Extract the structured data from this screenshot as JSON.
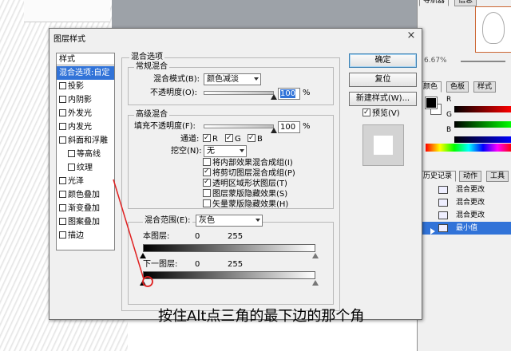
{
  "panels": {
    "navigator_tabs": [
      "导航器",
      "信息"
    ],
    "zoom": "6.67%",
    "color_tabs": [
      "颜色",
      "色板",
      "样式"
    ],
    "channels": [
      "R",
      "G",
      "B"
    ],
    "history_tabs": [
      "历史记录",
      "动作",
      "工具"
    ],
    "history_items": [
      "混合更改",
      "混合更改",
      "混合更改",
      "最小值"
    ],
    "accent": "#3173d8"
  },
  "dialog": {
    "title": "图层样式",
    "close_glyph": "×",
    "styles_header": "样式",
    "style_items": [
      {
        "label": "混合选项:自定",
        "checkbox": false,
        "selected": true,
        "indent": false
      },
      {
        "label": "投影",
        "checkbox": true,
        "selected": false,
        "indent": false
      },
      {
        "label": "内阴影",
        "checkbox": true,
        "selected": false,
        "indent": false
      },
      {
        "label": "外发光",
        "checkbox": true,
        "selected": false,
        "indent": false
      },
      {
        "label": "内发光",
        "checkbox": true,
        "selected": false,
        "indent": false
      },
      {
        "label": "斜面和浮雕",
        "checkbox": true,
        "selected": false,
        "indent": false
      },
      {
        "label": "等高线",
        "checkbox": true,
        "selected": false,
        "indent": true
      },
      {
        "label": "纹理",
        "checkbox": true,
        "selected": false,
        "indent": true
      },
      {
        "label": "光泽",
        "checkbox": true,
        "selected": false,
        "indent": false
      },
      {
        "label": "颜色叠加",
        "checkbox": true,
        "selected": false,
        "indent": false
      },
      {
        "label": "渐变叠加",
        "checkbox": true,
        "selected": false,
        "indent": false
      },
      {
        "label": "图案叠加",
        "checkbox": true,
        "selected": false,
        "indent": false
      },
      {
        "label": "描边",
        "checkbox": true,
        "selected": false,
        "indent": false
      }
    ],
    "blending_options_title": "混合选项",
    "general": {
      "title": "常规混合",
      "mode_label": "混合模式(B):",
      "mode_value": "颜色减淡",
      "opacity_label": "不透明度(O):",
      "opacity_value": "100",
      "opacity_unit": "%"
    },
    "advanced": {
      "title": "高级混合",
      "fill_label": "填充不透明度(F):",
      "fill_value": "100",
      "fill_unit": "%",
      "channels_label": "通道:",
      "channels": [
        {
          "label": "R",
          "checked": true
        },
        {
          "label": "G",
          "checked": true
        },
        {
          "label": "B",
          "checked": true
        }
      ],
      "knockout_label": "挖空(N):",
      "knockout_value": "无",
      "options": [
        {
          "label": "将内部效果混合成组(I)",
          "checked": false
        },
        {
          "label": "将剪切图层混合成组(P)",
          "checked": true
        },
        {
          "label": "透明区域形状图层(T)",
          "checked": true
        },
        {
          "label": "图层蒙版隐藏效果(S)",
          "checked": false
        },
        {
          "label": "矢量蒙版隐藏效果(H)",
          "checked": false
        }
      ]
    },
    "blend_if": {
      "label": "混合范围(E):",
      "value": "灰色",
      "this_layer_label": "本图层:",
      "this_min": "0",
      "this_max": "255",
      "under_layer_label": "下一图层:",
      "under_min": "0",
      "under_max": "255"
    },
    "buttons": {
      "ok": "确定",
      "reset": "复位",
      "new_style": "新建样式(W)...",
      "preview_label": "预览(V)",
      "preview_checked": true
    }
  },
  "annotation": {
    "caption": "按住Alt点三角的最下边的那个角",
    "line_color": "#e02020"
  }
}
